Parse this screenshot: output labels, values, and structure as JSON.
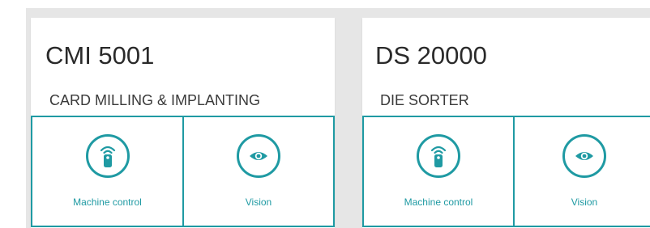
{
  "colors": {
    "accent": "#1f9aa3",
    "background": "#e6e6e6",
    "card": "#ffffff",
    "title_text": "#2a2a2a"
  },
  "cards": [
    {
      "title": "CMI 5001",
      "subtitle": "CARD MILLING & IMPLANTING",
      "tiles": [
        {
          "label": "Machine control",
          "icon": "remote-control-icon"
        },
        {
          "label": "Vision",
          "icon": "eye-icon"
        }
      ]
    },
    {
      "title": "DS 20000",
      "subtitle": "DIE SORTER",
      "tiles": [
        {
          "label": "Machine control",
          "icon": "remote-control-icon"
        },
        {
          "label": "Vision",
          "icon": "eye-icon"
        }
      ]
    }
  ]
}
